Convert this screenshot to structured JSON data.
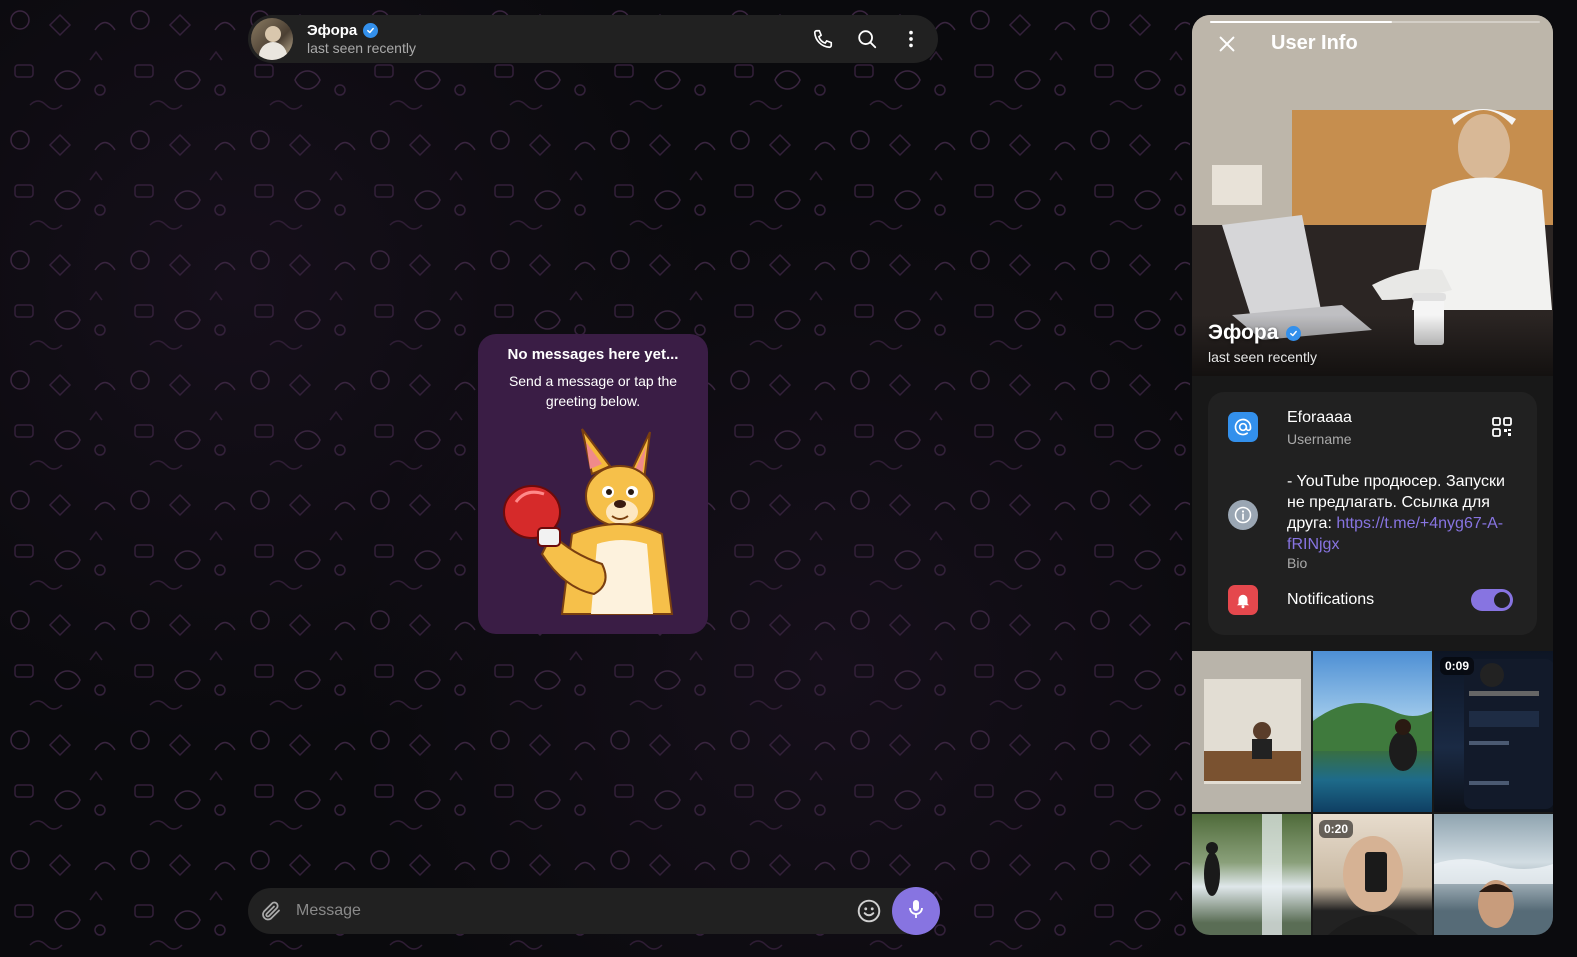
{
  "chat": {
    "name": "Эфора",
    "status": "last seen recently",
    "empty_title": "No messages here yet...",
    "empty_subtitle": "Send a message or tap the greeting below."
  },
  "header_actions": {
    "call_icon": "phone-icon",
    "search_icon": "search-icon",
    "menu_icon": "more-vertical-icon"
  },
  "composer": {
    "placeholder": "Message",
    "attach_icon": "paperclip-icon",
    "emoji_icon": "smile-icon",
    "mic_icon": "microphone-icon"
  },
  "user_info": {
    "title": "User Info",
    "name": "Эфора",
    "status": "last seen recently",
    "photo_progress": 0.55,
    "username": "Eforaaaa",
    "username_label": "Username",
    "bio_text": "- YouTube продюсер. Запуски не предлагать. Ссылка для друга: ",
    "bio_link": "https://t.me/+4nyg67-A-fRINjgx",
    "bio_label": "Bio",
    "notifications_label": "Notifications",
    "notifications_on": true
  },
  "media": [
    {
      "duration": ""
    },
    {
      "duration": ""
    },
    {
      "duration": "0:09"
    },
    {
      "duration": ""
    },
    {
      "duration": "0:20"
    },
    {
      "duration": ""
    }
  ],
  "colors": {
    "accent": "#8774e1",
    "verified": "#3390ec",
    "username_icon": "#3390ec",
    "bio_icon": "#9aa6b3",
    "notification_icon": "#e5484d",
    "card_bg": "#3a1d45"
  }
}
